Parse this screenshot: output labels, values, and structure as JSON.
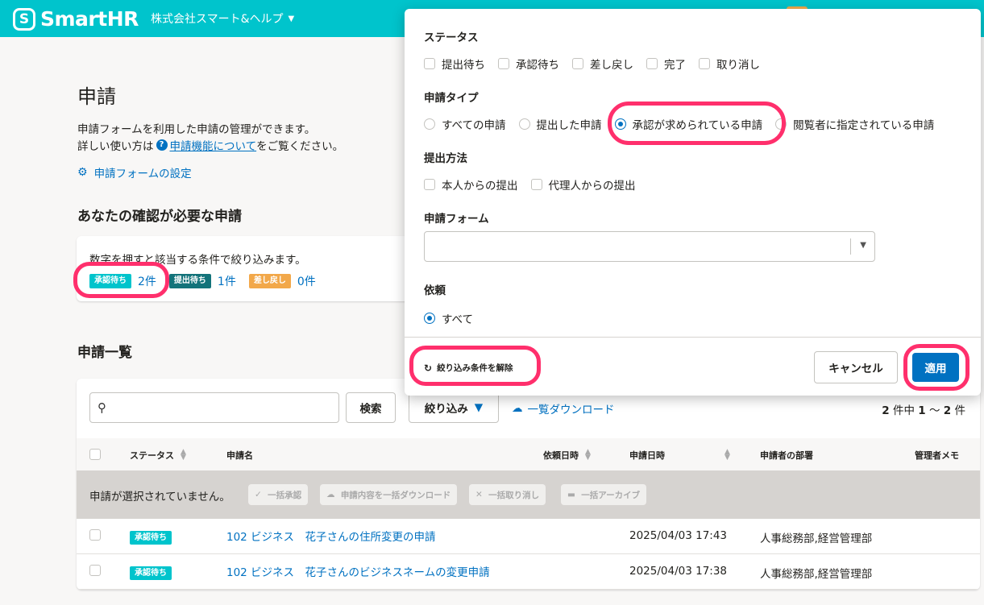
{
  "header": {
    "logo_mark": "S",
    "logo_text": "SmartHR",
    "company": "株式会社スマート&ヘルプ"
  },
  "page": {
    "title": "申請",
    "desc_line1": "申請フォームを利用した申請の管理ができます。",
    "desc_line2_prefix": "詳しい使い方は",
    "desc_help_link": "申請機能について",
    "desc_line2_suffix": "をご覧ください。",
    "settings_link": "申請フォームの設定"
  },
  "confirm": {
    "section_title": "あなたの確認が必要な申請",
    "instruction": "数字を押すと該当する条件で絞り込みます。",
    "statuses": [
      {
        "label": "承認待ち",
        "count": "2件"
      },
      {
        "label": "提出待ち",
        "count": "1件"
      },
      {
        "label": "差し戻し",
        "count": "0件"
      }
    ]
  },
  "list": {
    "section_title": "申請一覧",
    "search_button": "検索",
    "filter_button": "絞り込み",
    "download_link": "一覧ダウンロード",
    "paging_total": "2",
    "paging_mid": " 件中 ",
    "paging_from": "1",
    "paging_sep": " 〜 ",
    "paging_to": "2",
    "paging_unit": " 件",
    "columns": [
      "ステータス",
      "申請名",
      "依頼日時",
      "申請日時",
      "申請者の部署",
      "管理者メモ"
    ],
    "bulk_message": "申請が選択されていません。",
    "bulk_actions": [
      "一括承認",
      "申請内容を一括ダウンロード",
      "一括取り消し",
      "一括アーカイブ"
    ],
    "rows": [
      {
        "status": "承認待ち",
        "name": "102 ビジネス　花子さんの住所変更の申請",
        "requested_at": "2025/04/03 17:43",
        "department": "人事総務部,経営管理部"
      },
      {
        "status": "承認待ち",
        "name": "102 ビジネス　花子さんのビジネスネームの変更申請",
        "requested_at": "2025/04/03 17:38",
        "department": "人事総務部,経営管理部"
      }
    ]
  },
  "filter_panel": {
    "status_title": "ステータス",
    "status_options": [
      "提出待ち",
      "承認待ち",
      "差し戻し",
      "完了",
      "取り消し"
    ],
    "type_title": "申請タイプ",
    "type_options": [
      "すべての申請",
      "提出した申請",
      "承認が求められている申請",
      "閲覧者に指定されている申請"
    ],
    "type_selected": "承認が求められている申請",
    "method_title": "提出方法",
    "method_options": [
      "本人からの提出",
      "代理人からの提出"
    ],
    "form_title": "申請フォーム",
    "form_value": "",
    "request_title": "依頼",
    "request_options": [
      "すべて"
    ],
    "clear_label": "絞り込み条件を解除",
    "cancel_label": "キャンセル",
    "apply_label": "適用"
  },
  "colors": {
    "brand": "#00c4cc",
    "link": "#0071c1",
    "highlight": "#ff2f6c",
    "status_awaiting": "#00c4cc",
    "status_submitted": "#13737a",
    "status_returned": "#f2a84a"
  }
}
